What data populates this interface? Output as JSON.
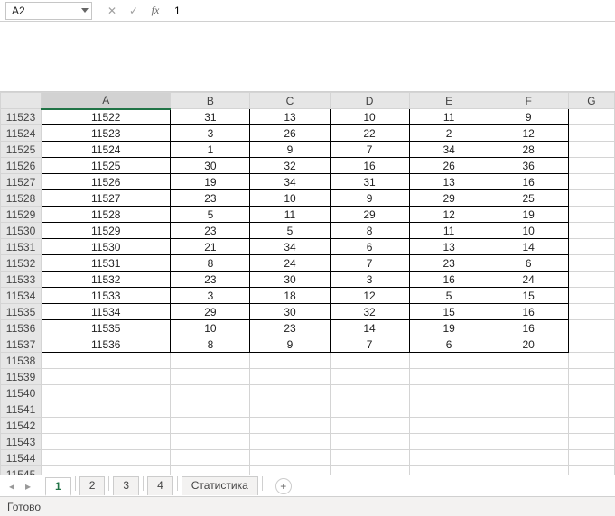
{
  "namebox": {
    "value": "A2"
  },
  "formula_bar": {
    "value": "1"
  },
  "columns": [
    "A",
    "B",
    "C",
    "D",
    "E",
    "F",
    "G"
  ],
  "selected_column": "A",
  "row_start": 11523,
  "visible_row_count": 23,
  "data_rows": [
    {
      "r": 11523,
      "cells": [
        "11522",
        "31",
        "13",
        "10",
        "11",
        "9"
      ]
    },
    {
      "r": 11524,
      "cells": [
        "11523",
        "3",
        "26",
        "22",
        "2",
        "12"
      ]
    },
    {
      "r": 11525,
      "cells": [
        "11524",
        "1",
        "9",
        "7",
        "34",
        "28"
      ]
    },
    {
      "r": 11526,
      "cells": [
        "11525",
        "30",
        "32",
        "16",
        "26",
        "36"
      ]
    },
    {
      "r": 11527,
      "cells": [
        "11526",
        "19",
        "34",
        "31",
        "13",
        "16"
      ]
    },
    {
      "r": 11528,
      "cells": [
        "11527",
        "23",
        "10",
        "9",
        "29",
        "25"
      ]
    },
    {
      "r": 11529,
      "cells": [
        "11528",
        "5",
        "11",
        "29",
        "12",
        "19"
      ]
    },
    {
      "r": 11530,
      "cells": [
        "11529",
        "23",
        "5",
        "8",
        "11",
        "10"
      ]
    },
    {
      "r": 11531,
      "cells": [
        "11530",
        "21",
        "34",
        "6",
        "13",
        "14"
      ]
    },
    {
      "r": 11532,
      "cells": [
        "11531",
        "8",
        "24",
        "7",
        "23",
        "6"
      ]
    },
    {
      "r": 11533,
      "cells": [
        "11532",
        "23",
        "30",
        "3",
        "16",
        "24"
      ]
    },
    {
      "r": 11534,
      "cells": [
        "11533",
        "3",
        "18",
        "12",
        "5",
        "15"
      ]
    },
    {
      "r": 11535,
      "cells": [
        "11534",
        "29",
        "30",
        "32",
        "15",
        "16"
      ]
    },
    {
      "r": 11536,
      "cells": [
        "11535",
        "10",
        "23",
        "14",
        "19",
        "16"
      ]
    },
    {
      "r": 11537,
      "cells": [
        "11536",
        "8",
        "9",
        "7",
        "6",
        "20"
      ]
    }
  ],
  "tabs": [
    {
      "label": "1",
      "active": true
    },
    {
      "label": "2",
      "active": false
    },
    {
      "label": "3",
      "active": false
    },
    {
      "label": "4",
      "active": false
    },
    {
      "label": "Статистика",
      "active": false
    }
  ],
  "status": {
    "text": "Готово"
  },
  "icons": {
    "cancel": "✕",
    "confirm": "✓",
    "fx": "fx",
    "left": "◂",
    "right": "▸",
    "plus": "+"
  }
}
